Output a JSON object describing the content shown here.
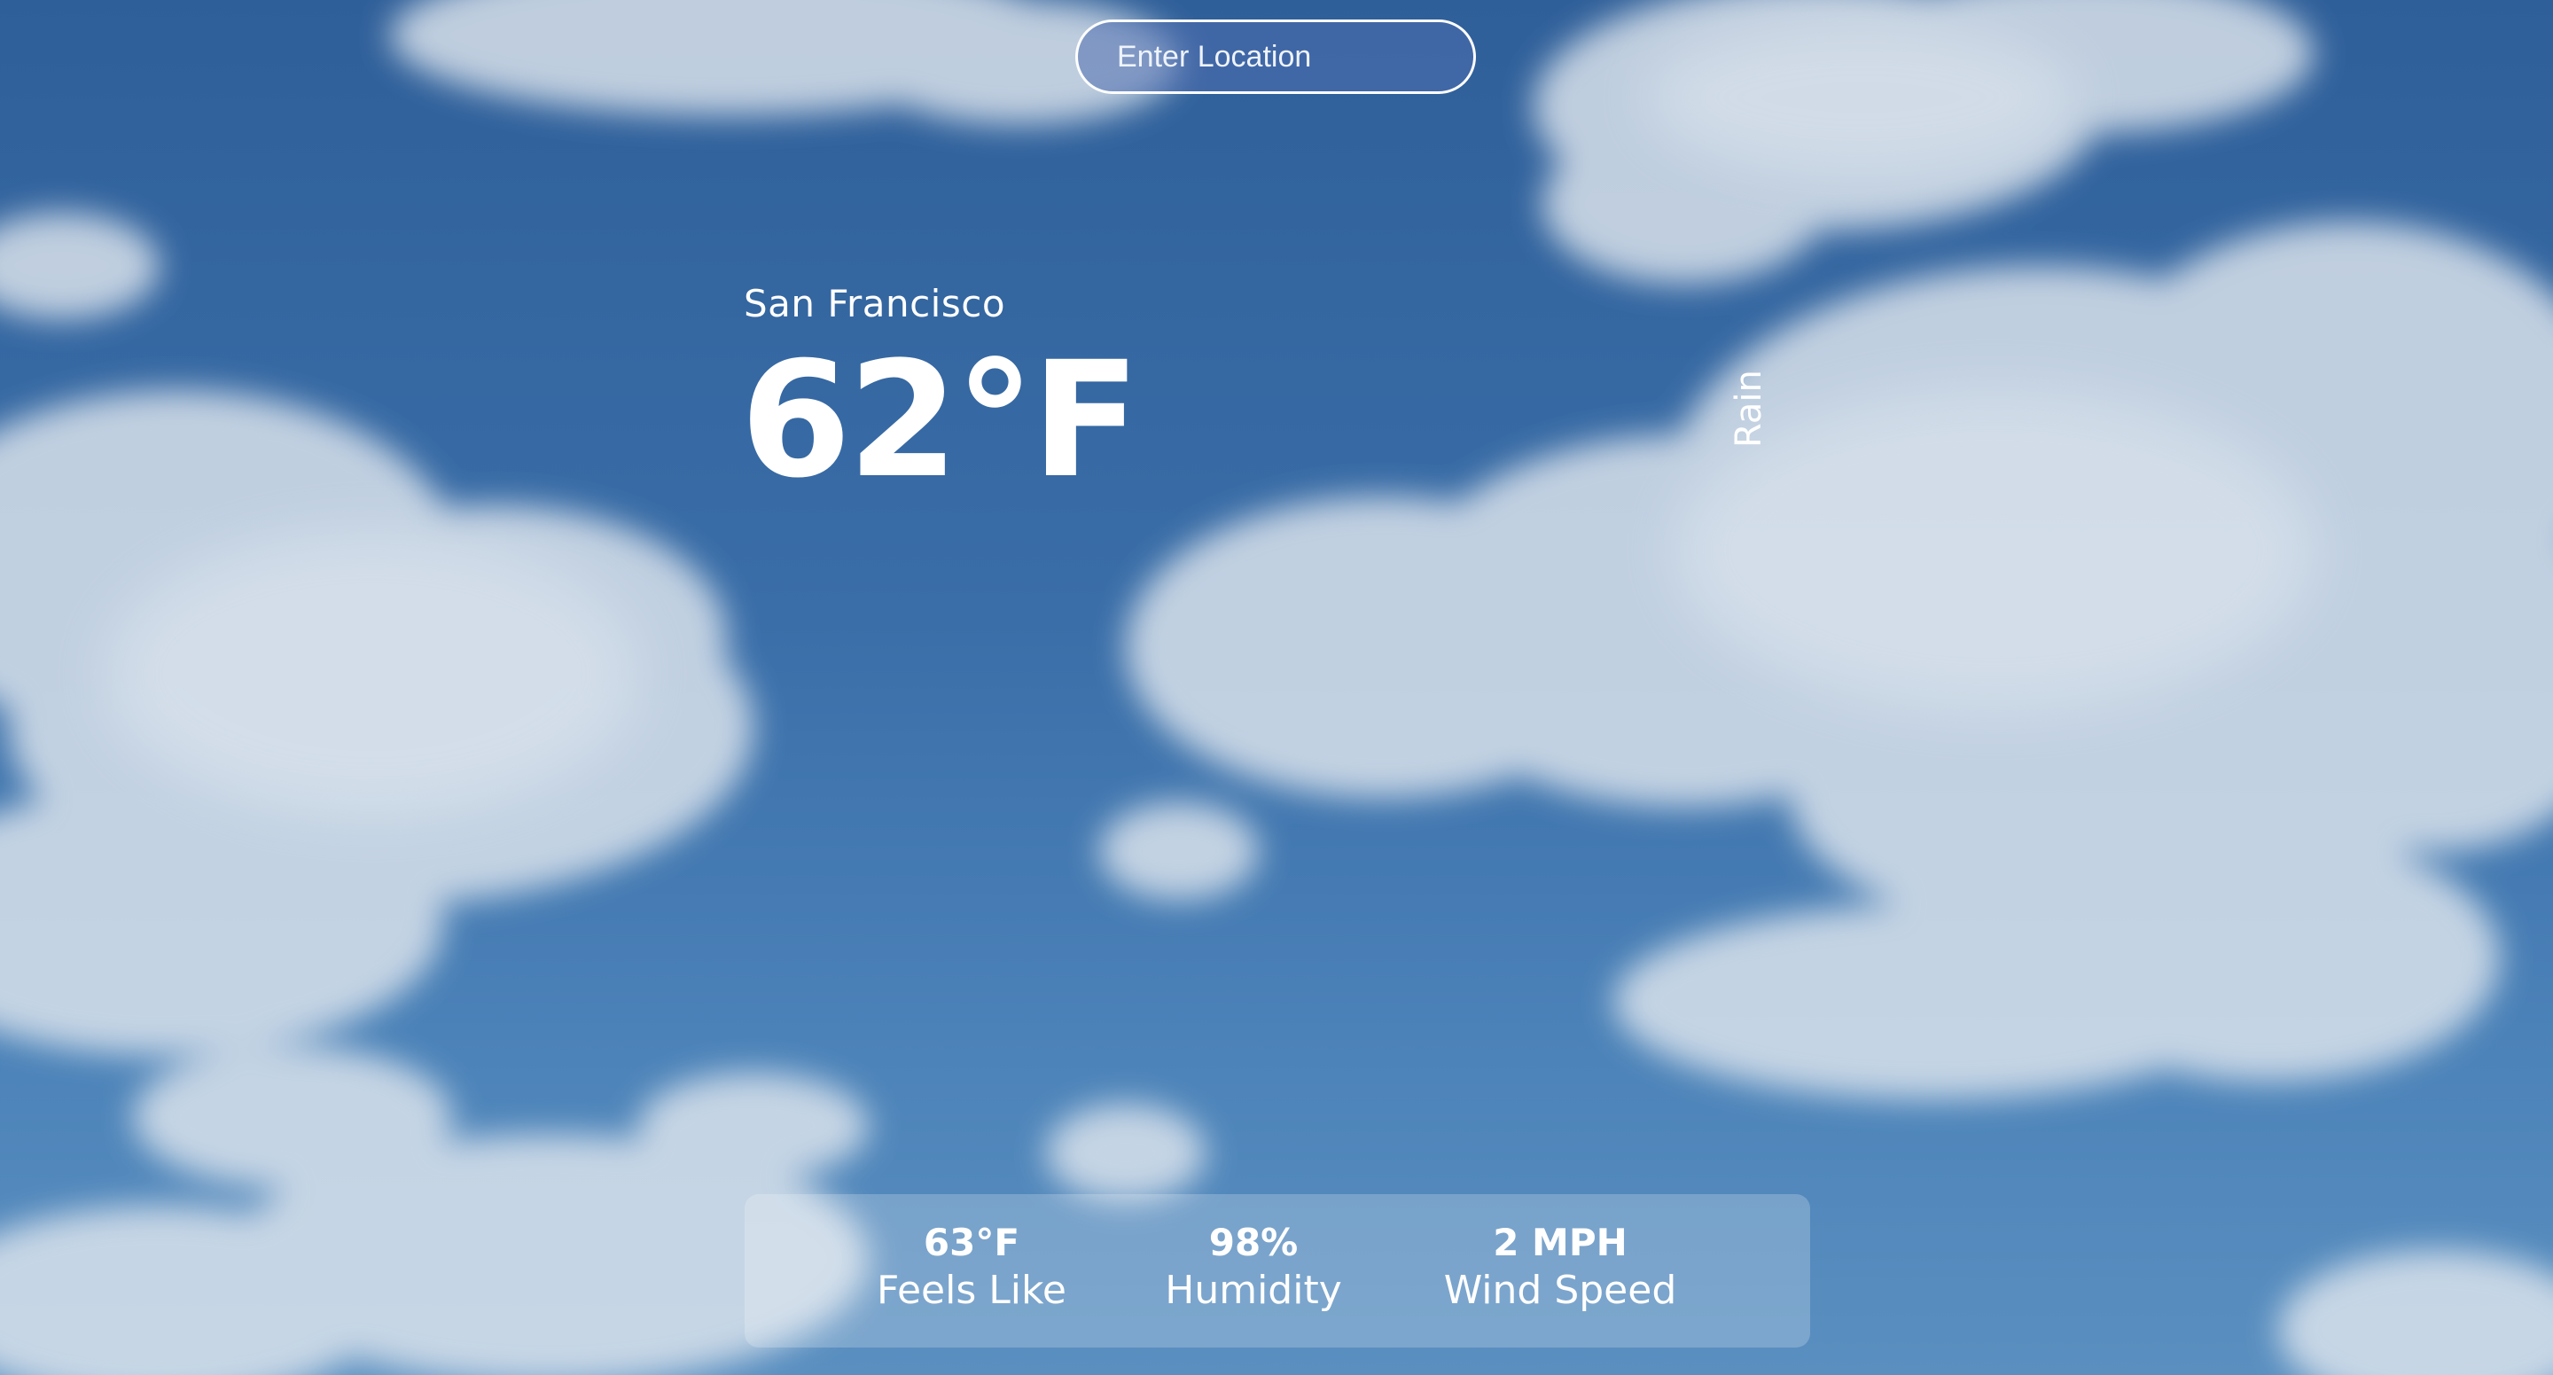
{
  "search": {
    "placeholder": "Enter Location"
  },
  "weather": {
    "city": "San Francisco",
    "temperature": "62°F",
    "condition": "Rain"
  },
  "stats": {
    "feels_like": {
      "value": "63°F",
      "label": "Feels Like"
    },
    "humidity": {
      "value": "98%",
      "label": "Humidity"
    },
    "wind_speed": {
      "value": "2 MPH",
      "label": "Wind Speed"
    }
  },
  "colors": {
    "sky_top": "#2f5f99",
    "sky_bottom": "#5a8fc0",
    "cloud": "#dfe6ee",
    "text": "#ffffff"
  },
  "background": {
    "icon": "cloudy-sky-background"
  }
}
